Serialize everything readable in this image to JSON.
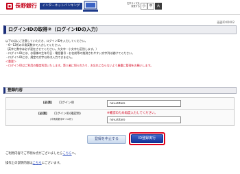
{
  "header": {
    "bank_name": "長野銀行",
    "ib_label": "インターネットバンキング",
    "font_size_label": "文字サイズを\n変更する",
    "font_sizes": [
      "小",
      "中",
      "大"
    ]
  },
  "screen_id": "画面ID:ID002",
  "page_title": "ログインIDの取得②（ログインIDの入力）",
  "notes": [
    {
      "text": "以下の点にご注意していただき、ログインIDを入力してください。",
      "style": "normal"
    },
    {
      "text": "・6～12桁の半角英数字で入力してください。",
      "style": "normal"
    },
    {
      "text": "（英字と数字は必ず混在させてください。大文字・小文字も区別します。）",
      "style": "normal"
    },
    {
      "text": "・ログインIDには、お客様の生年月日・電話番号・お名前等の推測されやすい文字列は避けてください。",
      "style": "normal"
    },
    {
      "text": "・ログインIDには、規定の文字以外は入力できません。",
      "style": "normal"
    },
    {
      "text": "＜重要＞",
      "style": "red"
    },
    {
      "text": "・ログインIDはご利用の都度利用いたします。第三者に知られたり、お忘れにならないよう厳重に管理をお願いします。",
      "style": "red"
    }
  ],
  "section_title": "登録内容",
  "form": {
    "row1": {
      "required": "[必須]",
      "label": "ログインID",
      "value": "nov20taro"
    },
    "row2": {
      "required": "[必須]",
      "label": "ログインID(確認用)",
      "sub": "(半角英数字6～12桁)",
      "note": "※確認のため再度入力してください。",
      "value": "nov20taro"
    }
  },
  "buttons": {
    "cancel": "登録を中止する",
    "register": "ID登録実行"
  },
  "footer": {
    "inquiry_text": "ご利用内容でご不明な点がございましたら",
    "inquiry_link": "こちら",
    "inquiry_suffix": "へ。",
    "manual_text": "操作上の説明内容は",
    "manual_link": "こちら",
    "manual_suffix": "にございます。"
  },
  "colors": {
    "brand_red": "#c40018",
    "brand_navy": "#1c2f7a",
    "warning_red": "#d3001c",
    "link_blue": "#1a3eb8"
  },
  "icons": [
    "bank-logo-icon",
    "computer-icon"
  ]
}
